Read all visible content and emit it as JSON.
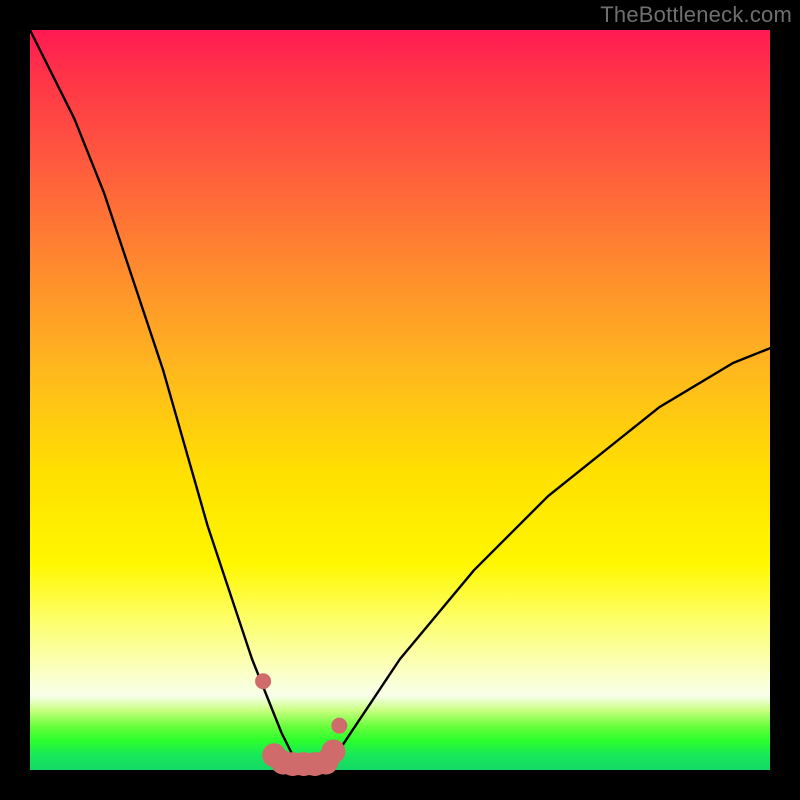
{
  "watermark": "TheBottleneck.com",
  "colors": {
    "frame": "#000000",
    "watermark": "#6f6f6f",
    "curve": "#000000",
    "marker": "#cf6b6b",
    "gradient_stops": [
      "#ff1a53",
      "#ff3348",
      "#ff5a3e",
      "#ff8a2e",
      "#ffb81e",
      "#ffe000",
      "#fff700",
      "#fdff6e",
      "#fbffc8",
      "#f7ffea",
      "#c7ff7d",
      "#6cff3e",
      "#2cff2c",
      "#18e85a",
      "#14d866"
    ]
  },
  "chart_data": {
    "type": "line",
    "title": "",
    "xlabel": "",
    "ylabel": "",
    "xlim": [
      0,
      100
    ],
    "ylim": [
      0,
      100
    ],
    "note": "Bottleneck-style curve: y ≈ 100 at x=0, drops to ~0 near x≈36, stays ≈0 over x≈33–41, rises to ~57 at x=100. Values are raster estimates (no axis ticks shown).",
    "series": [
      {
        "name": "bottleneck-curve",
        "x": [
          0,
          2,
          4,
          6,
          8,
          10,
          12,
          14,
          16,
          18,
          20,
          22,
          24,
          26,
          28,
          30,
          32,
          34,
          36,
          38,
          40,
          42,
          44,
          46,
          48,
          50,
          55,
          60,
          65,
          70,
          75,
          80,
          85,
          90,
          95,
          100
        ],
        "y": [
          100,
          96,
          92,
          88,
          83,
          78,
          72,
          66,
          60,
          54,
          47,
          40,
          33,
          27,
          21,
          15,
          10,
          5,
          1,
          0.5,
          1,
          3,
          6,
          9,
          12,
          15,
          21,
          27,
          32,
          37,
          41,
          45,
          49,
          52,
          55,
          57
        ]
      }
    ],
    "bottom_markers": {
      "name": "optimal-range-markers",
      "color": "#cf6b6b",
      "points_x": [
        31.5,
        33.0,
        34.2,
        35.5,
        37.0,
        38.5,
        40.0,
        41.0,
        41.8
      ],
      "points_y": [
        12,
        2,
        1,
        0.8,
        0.8,
        0.8,
        1,
        2.5,
        6
      ]
    }
  }
}
